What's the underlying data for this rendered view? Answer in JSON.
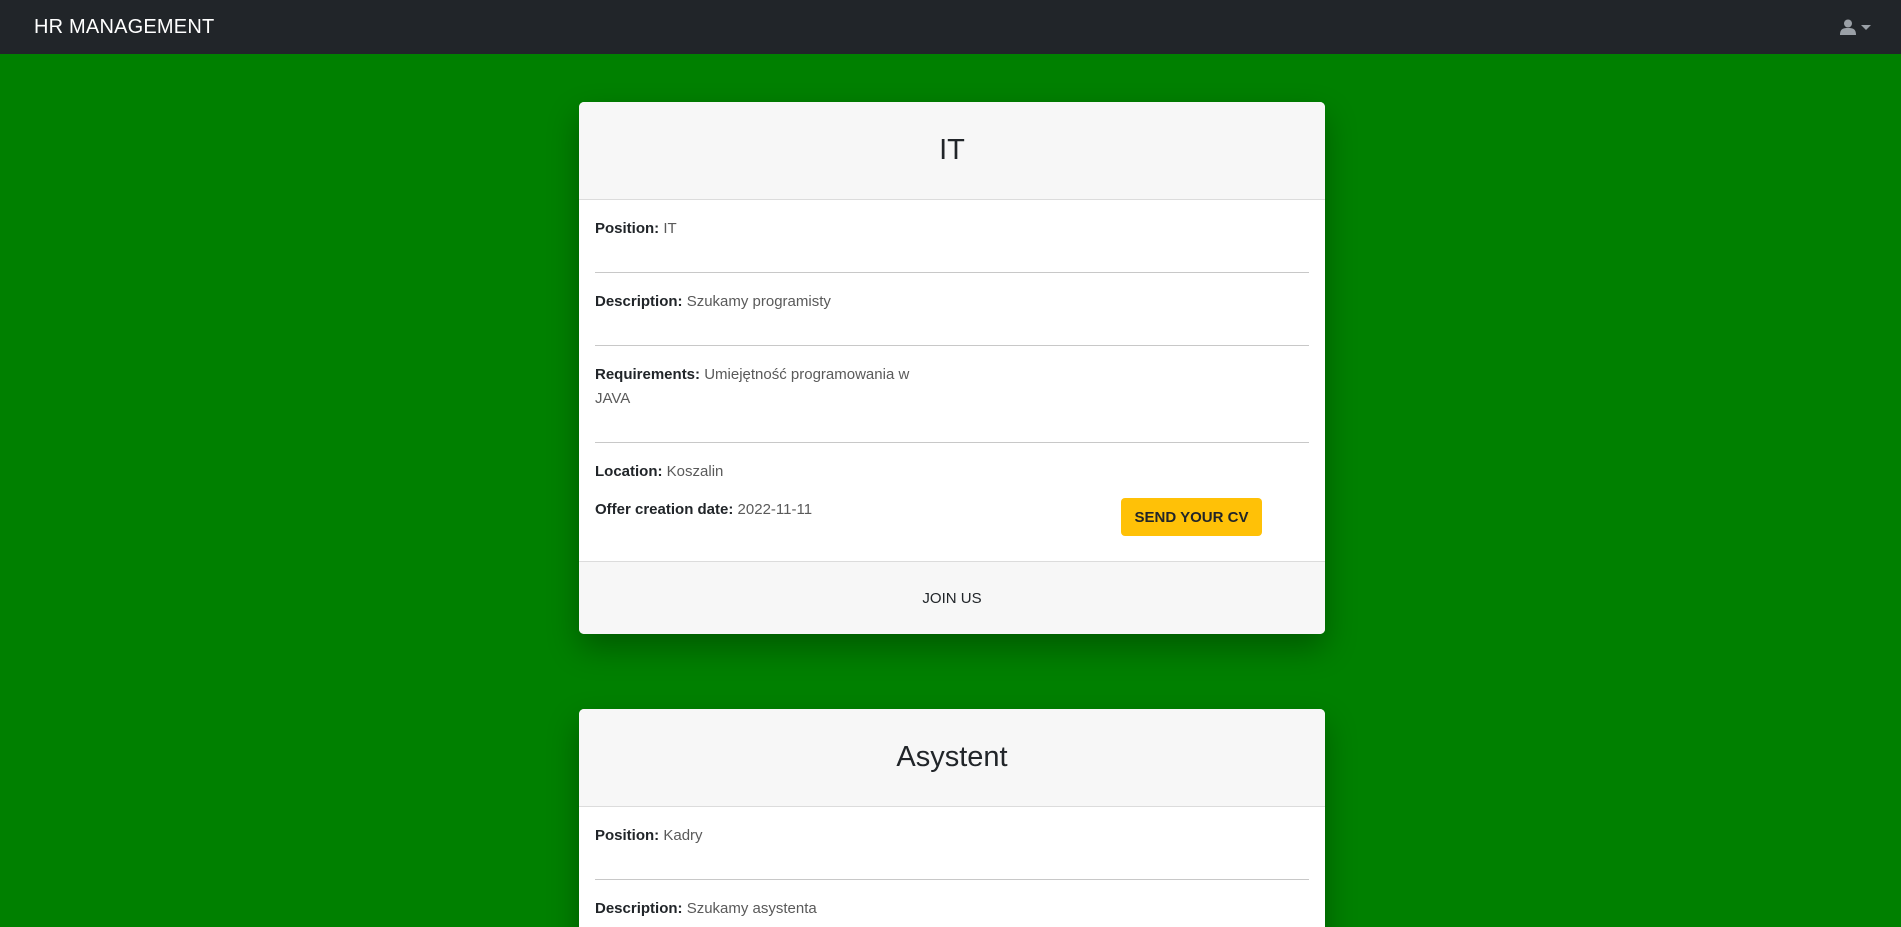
{
  "navbar": {
    "brand": "HR MANAGEMENT",
    "user_icon": "user-icon",
    "caret_icon": "caret-down-icon"
  },
  "labels": {
    "position": "Position:",
    "description": "Description:",
    "requirements": "Requirements:",
    "location": "Location:",
    "offer_date": "Offer creation date:"
  },
  "offers": [
    {
      "title": "IT",
      "position": "IT",
      "description": "Szukamy programisty",
      "requirements": "Umiejętność programowania w JAVA",
      "location": "Koszalin",
      "offer_date": "2022-11-11",
      "cv_button": "SEND YOUR CV",
      "footer": "JOIN US"
    },
    {
      "title": "Asystent",
      "position": "Kadry",
      "description": "Szukamy asystenta"
    }
  ],
  "colors": {
    "background": "#008000",
    "navbar": "#212529",
    "button": "#ffc107"
  }
}
